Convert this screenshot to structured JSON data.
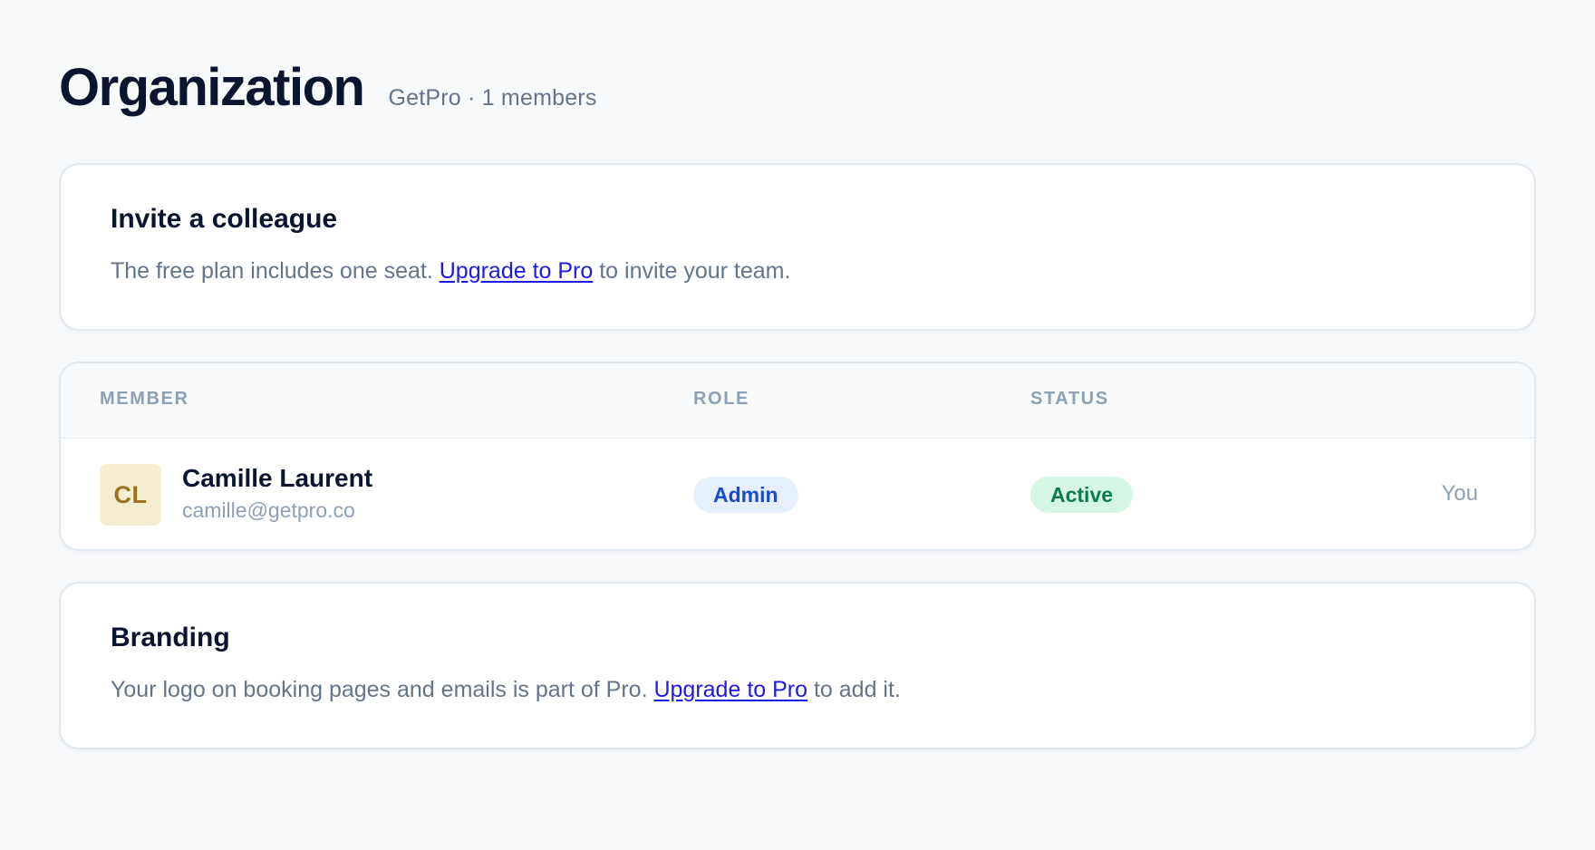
{
  "header": {
    "title": "Organization",
    "subtitle": "GetPro · 1 members"
  },
  "invite": {
    "title": "Invite a colleague",
    "text_before": "The free plan includes one seat. ",
    "link_label": "Upgrade to Pro",
    "text_after": " to invite your team."
  },
  "members_table": {
    "columns": {
      "member": "MEMBER",
      "role": "ROLE",
      "status": "STATUS"
    },
    "rows": [
      {
        "initials": "CL",
        "name": "Camille Laurent",
        "email": "camille@getpro.co",
        "role": "Admin",
        "status": "Active",
        "note": "You"
      }
    ]
  },
  "branding": {
    "title": "Branding",
    "text_before": "Your logo on booking pages and emails is part of Pro. ",
    "link_label": "Upgrade to Pro",
    "text_after": " to add it."
  },
  "colors": {
    "link": "#1d1ae8",
    "role_badge_bg": "#e6effd",
    "role_badge_text": "#1a49d0",
    "status_badge_bg": "#d5f6e5",
    "status_badge_text": "#0d7a4d",
    "avatar_bg": "#f6ecd0",
    "avatar_text": "#9a7420"
  }
}
